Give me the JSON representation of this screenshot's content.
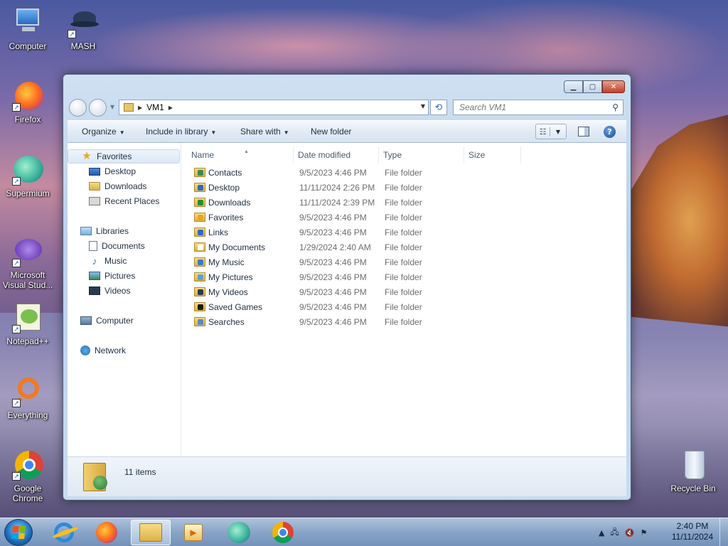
{
  "desktop": {
    "icons": [
      {
        "label": "Computer"
      },
      {
        "label": "MASH"
      },
      {
        "label": "Firefox"
      },
      {
        "label": "Supermium"
      },
      {
        "label": "Microsoft Visual Stud..."
      },
      {
        "label": "Notepad++"
      },
      {
        "label": "Everything"
      },
      {
        "label": "Google Chrome"
      },
      {
        "label": "Recycle Bin"
      }
    ]
  },
  "window": {
    "address": {
      "path": [
        "VM1"
      ]
    },
    "search": {
      "placeholder": "Search VM1"
    },
    "toolbar": {
      "organize": "Organize",
      "include_in_library": "Include in library",
      "share_with": "Share with",
      "new_folder": "New folder"
    },
    "nav": {
      "favorites": {
        "label": "Favorites",
        "items": [
          "Desktop",
          "Downloads",
          "Recent Places"
        ]
      },
      "libraries": {
        "label": "Libraries",
        "items": [
          "Documents",
          "Music",
          "Pictures",
          "Videos"
        ]
      },
      "computer": "Computer",
      "network": "Network"
    },
    "columns": {
      "name": "Name",
      "date_modified": "Date modified",
      "type": "Type",
      "size": "Size"
    },
    "files": [
      {
        "name": "Contacts",
        "date": "9/5/2023 4:46 PM",
        "type": "File folder",
        "overlay": "#3a8a50"
      },
      {
        "name": "Desktop",
        "date": "11/11/2024 2:26 PM",
        "type": "File folder",
        "overlay": "#2a6ac8"
      },
      {
        "name": "Downloads",
        "date": "11/11/2024 2:39 PM",
        "type": "File folder",
        "overlay": "#2a8a3a"
      },
      {
        "name": "Favorites",
        "date": "9/5/2023 4:46 PM",
        "type": "File folder",
        "overlay": "#e8a820"
      },
      {
        "name": "Links",
        "date": "9/5/2023 4:46 PM",
        "type": "File folder",
        "overlay": "#2a6ac8"
      },
      {
        "name": "My Documents",
        "date": "1/29/2024 2:40 AM",
        "type": "File folder",
        "overlay": "#ffffff"
      },
      {
        "name": "My Music",
        "date": "9/5/2023 4:46 PM",
        "type": "File folder",
        "overlay": "#3a7ac8"
      },
      {
        "name": "My Pictures",
        "date": "9/5/2023 4:46 PM",
        "type": "File folder",
        "overlay": "#5aa0d8"
      },
      {
        "name": "My Videos",
        "date": "9/5/2023 4:46 PM",
        "type": "File folder",
        "overlay": "#2a3a50"
      },
      {
        "name": "Saved Games",
        "date": "9/5/2023 4:46 PM",
        "type": "File folder",
        "overlay": "#1a1a1a"
      },
      {
        "name": "Searches",
        "date": "9/5/2023 4:46 PM",
        "type": "File folder",
        "overlay": "#5a8ac8"
      }
    ],
    "details": {
      "count": "11 items"
    }
  },
  "taskbar": {
    "clock_time": "2:40 PM",
    "clock_date": "11/11/2024"
  }
}
